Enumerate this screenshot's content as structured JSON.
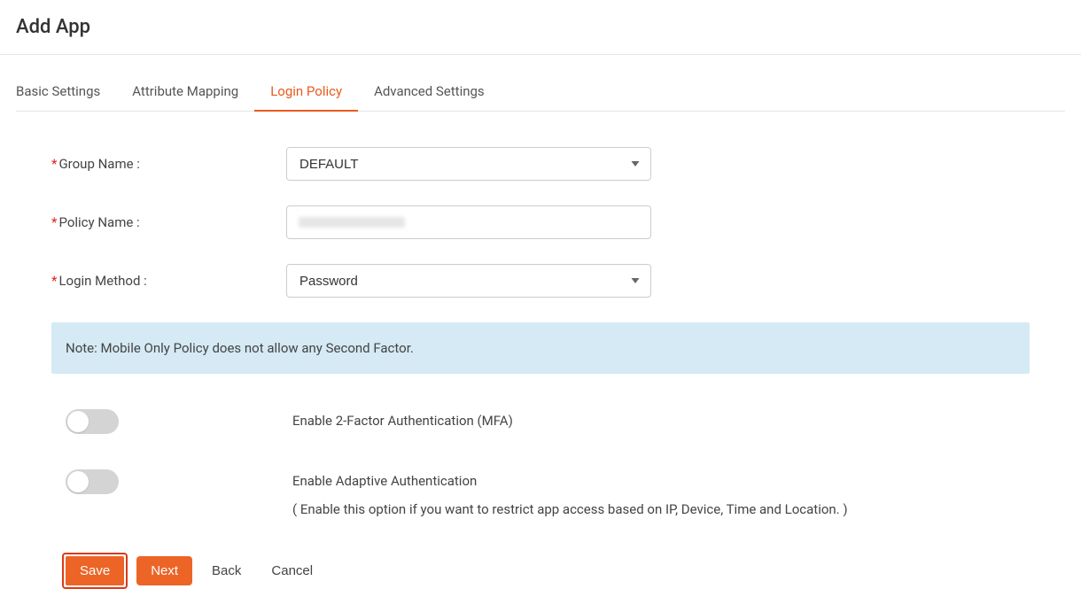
{
  "header": {
    "title": "Add App"
  },
  "tabs": {
    "basic": "Basic Settings",
    "attribute": "Attribute Mapping",
    "login": "Login Policy",
    "advanced": "Advanced Settings"
  },
  "form": {
    "group_name_label": "Group Name :",
    "group_name_value": "DEFAULT",
    "policy_name_label": "Policy Name :",
    "policy_name_value": "",
    "login_method_label": "Login Method :",
    "login_method_value": "Password"
  },
  "note": "Note: Mobile Only Policy does not allow any Second Factor.",
  "toggles": {
    "mfa_label": "Enable 2-Factor Authentication (MFA)",
    "adaptive_label": "Enable Adaptive Authentication",
    "adaptive_sub": "( Enable this option if you want to restrict app access based on IP, Device, Time and Location. )"
  },
  "buttons": {
    "save": "Save",
    "next": "Next",
    "back": "Back",
    "cancel": "Cancel"
  }
}
